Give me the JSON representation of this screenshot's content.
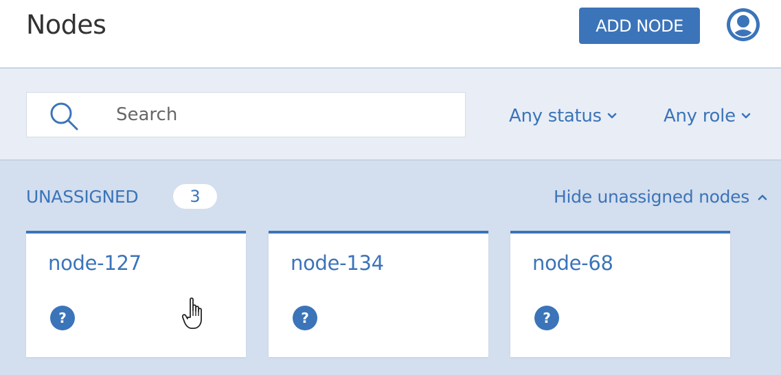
{
  "header": {
    "title": "Nodes",
    "add_button_label": "ADD NODE",
    "avatar_icon": "user-avatar-icon"
  },
  "filters": {
    "search_placeholder": "Search",
    "search_value": "",
    "search_icon": "search-icon",
    "status_label": "Any status",
    "role_label": "Any role",
    "dropdown_icon": "chevron-down-icon"
  },
  "unassigned": {
    "title": "UNASSIGNED",
    "count": "3",
    "hide_label": "Hide unassigned nodes",
    "hide_icon": "chevron-up-icon",
    "nodes": [
      {
        "name": "node-127",
        "status_icon": "unknown-status-icon"
      },
      {
        "name": "node-134",
        "status_icon": "unknown-status-icon"
      },
      {
        "name": "node-68",
        "status_icon": "unknown-status-icon"
      }
    ]
  },
  "colors": {
    "accent": "#3b74b9",
    "filter_bar_bg": "#e9eef6",
    "section_bg": "#d3deee",
    "card_bg": "#ffffff"
  }
}
